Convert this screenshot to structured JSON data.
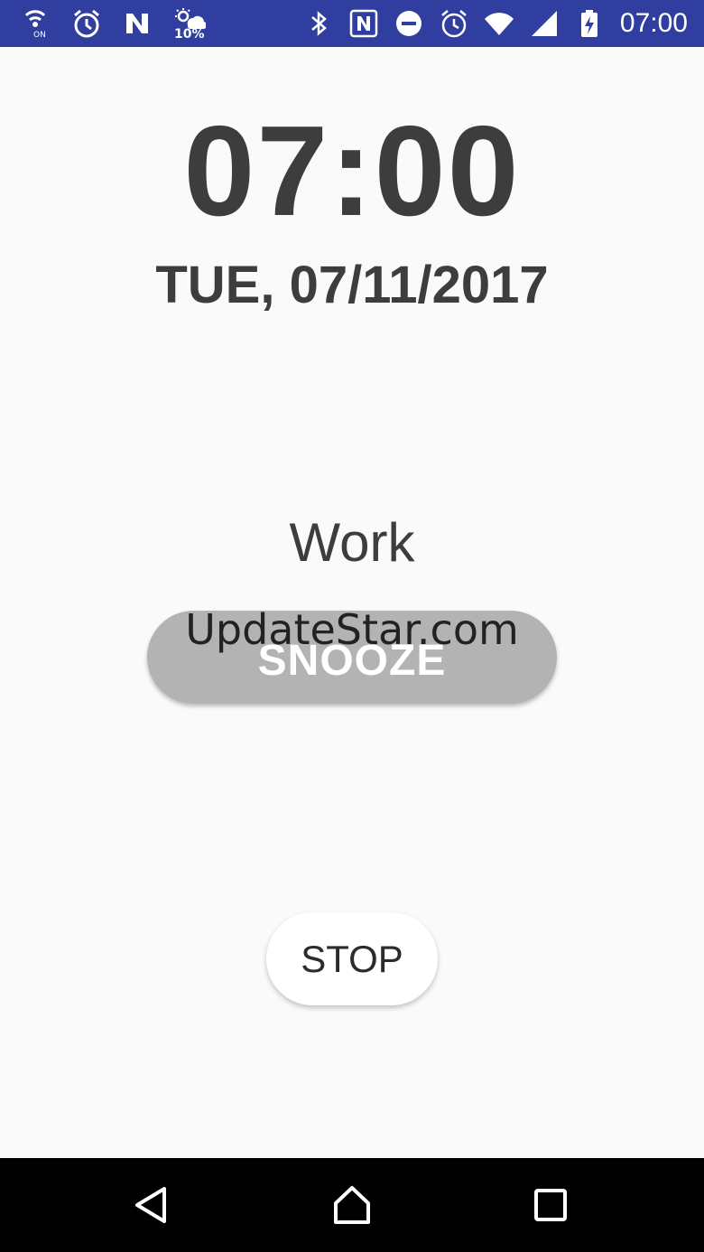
{
  "status_bar": {
    "weather_percent": "10%",
    "time": "07:00",
    "left_icons": [
      "wifi-calling-icon",
      "alarm-clock-icon",
      "n-app-icon",
      "weather-icon"
    ],
    "right_icons": [
      "bluetooth-icon",
      "nfc-icon",
      "do-not-disturb-icon",
      "alarm-icon",
      "wifi-icon",
      "signal-icon",
      "battery-charging-icon"
    ],
    "color": "#303f9f"
  },
  "clock": {
    "time": "07:00",
    "date": "TUE, 07/11/2017"
  },
  "alarm": {
    "label": "Work"
  },
  "buttons": {
    "snooze_label": "SNOOZE",
    "stop_label": "STOP"
  },
  "watermark": {
    "text": "UpdateStar.com"
  },
  "nav_bar": {
    "icons": [
      "back-icon",
      "home-icon",
      "recents-icon"
    ]
  }
}
